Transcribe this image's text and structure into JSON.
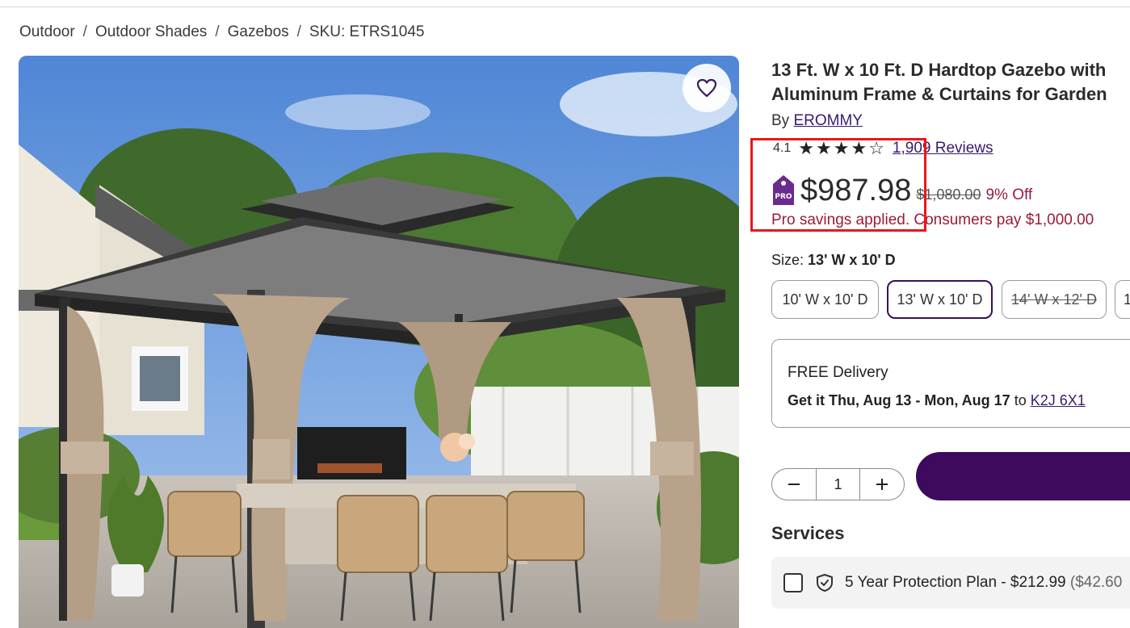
{
  "breadcrumb": {
    "items": [
      "Outdoor",
      "Outdoor Shades",
      "Gazebos"
    ],
    "sku": "SKU: ETRS1045",
    "separator": "/"
  },
  "product": {
    "title_line1": "13 Ft. W x 10 Ft. D Hardtop Gazebo with",
    "title_line2": "Aluminum Frame & Curtains for Garden",
    "by_prefix": "By",
    "brand": "EROMMY",
    "rating": "4.1",
    "stars_filled": 4,
    "stars_total": 5,
    "reviews": "1,909 Reviews",
    "price": "$987.98",
    "old_price": "$1,080.00",
    "discount": "9% Off",
    "pro_badge": "PRO",
    "pro_savings": "Pro savings applied. Consumers pay $1,000.00"
  },
  "size": {
    "label": "Size:",
    "selected": "13' W x 10' D",
    "options": [
      {
        "label": "10' W x 10' D",
        "state": "available"
      },
      {
        "label": "13' W x 10' D",
        "state": "selected"
      },
      {
        "label": "14' W x 12' D",
        "state": "unavailable"
      },
      {
        "label": "1",
        "state": "available"
      }
    ]
  },
  "delivery": {
    "title": "FREE Delivery",
    "prefix": "Get it Thu, Aug 13 - Mon, Aug 17",
    "to": "to",
    "postal_code": "K2J 6X1"
  },
  "quantity": {
    "value": "1",
    "minus_icon": "minus-icon",
    "plus_icon": "plus-icon"
  },
  "services": {
    "heading": "Services",
    "plan_label": "5 Year Protection Plan - $212.99",
    "plan_extra": "($42.60"
  },
  "colors": {
    "accent_purple": "#3d0a5e",
    "sale_red": "#9b1b3a",
    "highlight_red": "#e8171a"
  }
}
